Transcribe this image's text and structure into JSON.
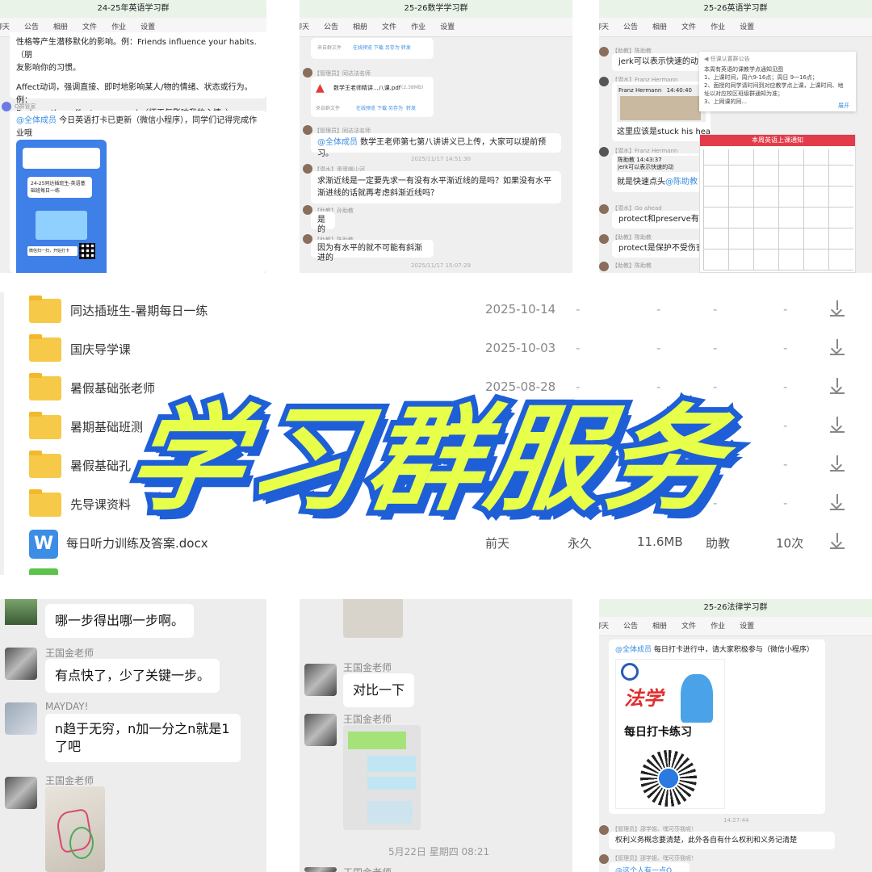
{
  "panel_english": {
    "title": "24-25年英语学习群",
    "tabs": [
      "聊天",
      "公告",
      "相册",
      "文件",
      "作业",
      "设置"
    ],
    "msg1_line1": "性格等产生潜移默化的影响。例：Friends influence your habits.（朋",
    "msg1_line2": "友影响你的习惯。",
    "msg1_line3": "Affect动词，强调直接、即时地影响某人/物的情绪、状态或行为。例：",
    "msg1_line4": "Bad weather affects my mood.（坏天气影响我的心情。）",
    "sender2": "Q群管家",
    "mention": "@全体成员",
    "msg2_rest": " 今日英语打卡已更新（微信小程序），同学们记得完成作业哦",
    "card_title": "24-25同达插班生-英语基础班每日一练",
    "card_caption": "微信扫一扫，开始打卡"
  },
  "panel_math": {
    "title": "25-26数学学习群",
    "tabs": [
      "聊天",
      "公告",
      "相册",
      "文件",
      "作业",
      "设置"
    ],
    "file_from": "来自群文件",
    "file_actions": [
      "在线预览",
      "下载",
      "另存为",
      "转发"
    ],
    "sender_a": "【管理员】同达法名师",
    "file_name": "数学王老师精讲...八课.pdf",
    "file_size": "(2.38MB)",
    "sender_b": "【管理员】同达法名师",
    "mention": "@全体成员",
    "notice": " 数学王老师第七第八讲讲义已上传，大家可以提前预习。",
    "ts1": "2025/11/17 14:51:30",
    "sender_c": "【潜水】蛋蛋哪山河",
    "question": "求渐近线是一定要先求一有没有水平渐近线的是吗？如果没有水平渐进线的话就再考虑斜渐近线吗？",
    "sender_d": "【助教】孙助教",
    "answer1": "是的",
    "sender_e": "【助教】陈助教",
    "answer2": "因为有水平的就不可能有斜渐进的",
    "ts2": "2025/11/17 15:07:29"
  },
  "panel_english2": {
    "title": "25-26英语学习群",
    "tabs": [
      "聊天",
      "公告",
      "相册",
      "文件",
      "作业",
      "设置"
    ],
    "s1": "【助教】陈助教",
    "m1": "jerk可以表示快速的动",
    "s2": "【潜水】Franz Hermann",
    "quote_name": "Franz Hermann",
    "quote_time": "14:40:40",
    "m2": "这里应该是stuck his hea",
    "s3": "【潜水】Franz Hermann",
    "reply_name": "陈助教",
    "reply_time": "14:43:37",
    "reply_text": "jerk可以表示快速的动",
    "m3_pre": "就是快速点头",
    "m3_mention": "@陈助教",
    "s4": "【潜水】Go ahead",
    "m4": "protect和preserve有什",
    "s5": "【助教】陈助教",
    "m5": "protect是保护不受伤害",
    "s6": "【助教】陈助教",
    "notice_head": "任课认置群公告",
    "notice_lines": [
      "本周有英语的课教学点通知见图",
      "1、上课时间，周六9-16点；周日 9一16点；",
      "2、面授的同学请时间到对应教学点上课，上课时间、地",
      "址以对应校区班级群通知为准；",
      "3、上网课的同..."
    ],
    "expand": "展开",
    "table_title": "本周英语上课通知"
  },
  "files": {
    "rows": [
      {
        "name": "同达插班生-暑期每日一练",
        "date": "2025-10-14",
        "expiry": "-",
        "size": "-",
        "uploader": "-",
        "count": "-"
      },
      {
        "name": "国庆导学课",
        "date": "2025-10-03",
        "expiry": "-",
        "size": "-",
        "uploader": "-",
        "count": "-"
      },
      {
        "name": "暑假基础张老师",
        "date": "2025-08-28",
        "expiry": "-",
        "size": "-",
        "uploader": "-",
        "count": "-"
      },
      {
        "name": "暑期基础班测",
        "date": "",
        "expiry": "-",
        "size": "-",
        "uploader": "-",
        "count": "-"
      },
      {
        "name": "暑假基础孔",
        "date": "",
        "expiry": "-",
        "size": "-",
        "uploader": "-",
        "count": "-"
      },
      {
        "name": "先导课资料",
        "date": "",
        "expiry": "-",
        "size": "-",
        "uploader": "-",
        "count": "-"
      },
      {
        "name": "每日听力训练及答案.docx",
        "date": "前天",
        "expiry": "永久",
        "size": "11.6MB",
        "uploader": "助教",
        "count": "10次"
      }
    ]
  },
  "banner": {
    "text": "学习群服务"
  },
  "panel_wechat1": {
    "m0": "哪一步得出哪一步啊。",
    "name1": "王国金老师",
    "m1": "有点快了，少了关键一步。",
    "name2": "MAYDAY!",
    "m2_line1": "n趋于无穷，n加一分之n就是1",
    "m2_line2": "了吧",
    "name3": "王国金老师"
  },
  "panel_wechat2": {
    "name1": "王国金老师",
    "m1": "对比一下",
    "name2": "王国金老师",
    "date": "5月22日 星期四 08:21",
    "name3": "王国金老师"
  },
  "panel_law": {
    "title": "25-26法律学习群",
    "tabs": [
      "聊天",
      "公告",
      "相册",
      "文件",
      "作业",
      "设置"
    ],
    "mention": "@全体成员",
    "notice": " 每日打卡进行中，请大家积极参与（微信小程序）",
    "poster_title": "法学",
    "poster_sub": "每日打卡练习",
    "ts": "14:27:44",
    "s1": "【管理员】邵学姐、嘿可莎我呢！",
    "m1": "权利义务概念要清楚，此外各自有什么权利和义务记清楚",
    "s2": "【管理员】邵学姐、嘿可莎我呢！",
    "m2": "@这个人有一点Q"
  },
  "colors": {
    "banner_fill": "#e8ff4a",
    "banner_stroke": "#1e5fd8",
    "link": "#3a8de3",
    "folder": "#f7c948",
    "table_head": "#e23b4a"
  }
}
